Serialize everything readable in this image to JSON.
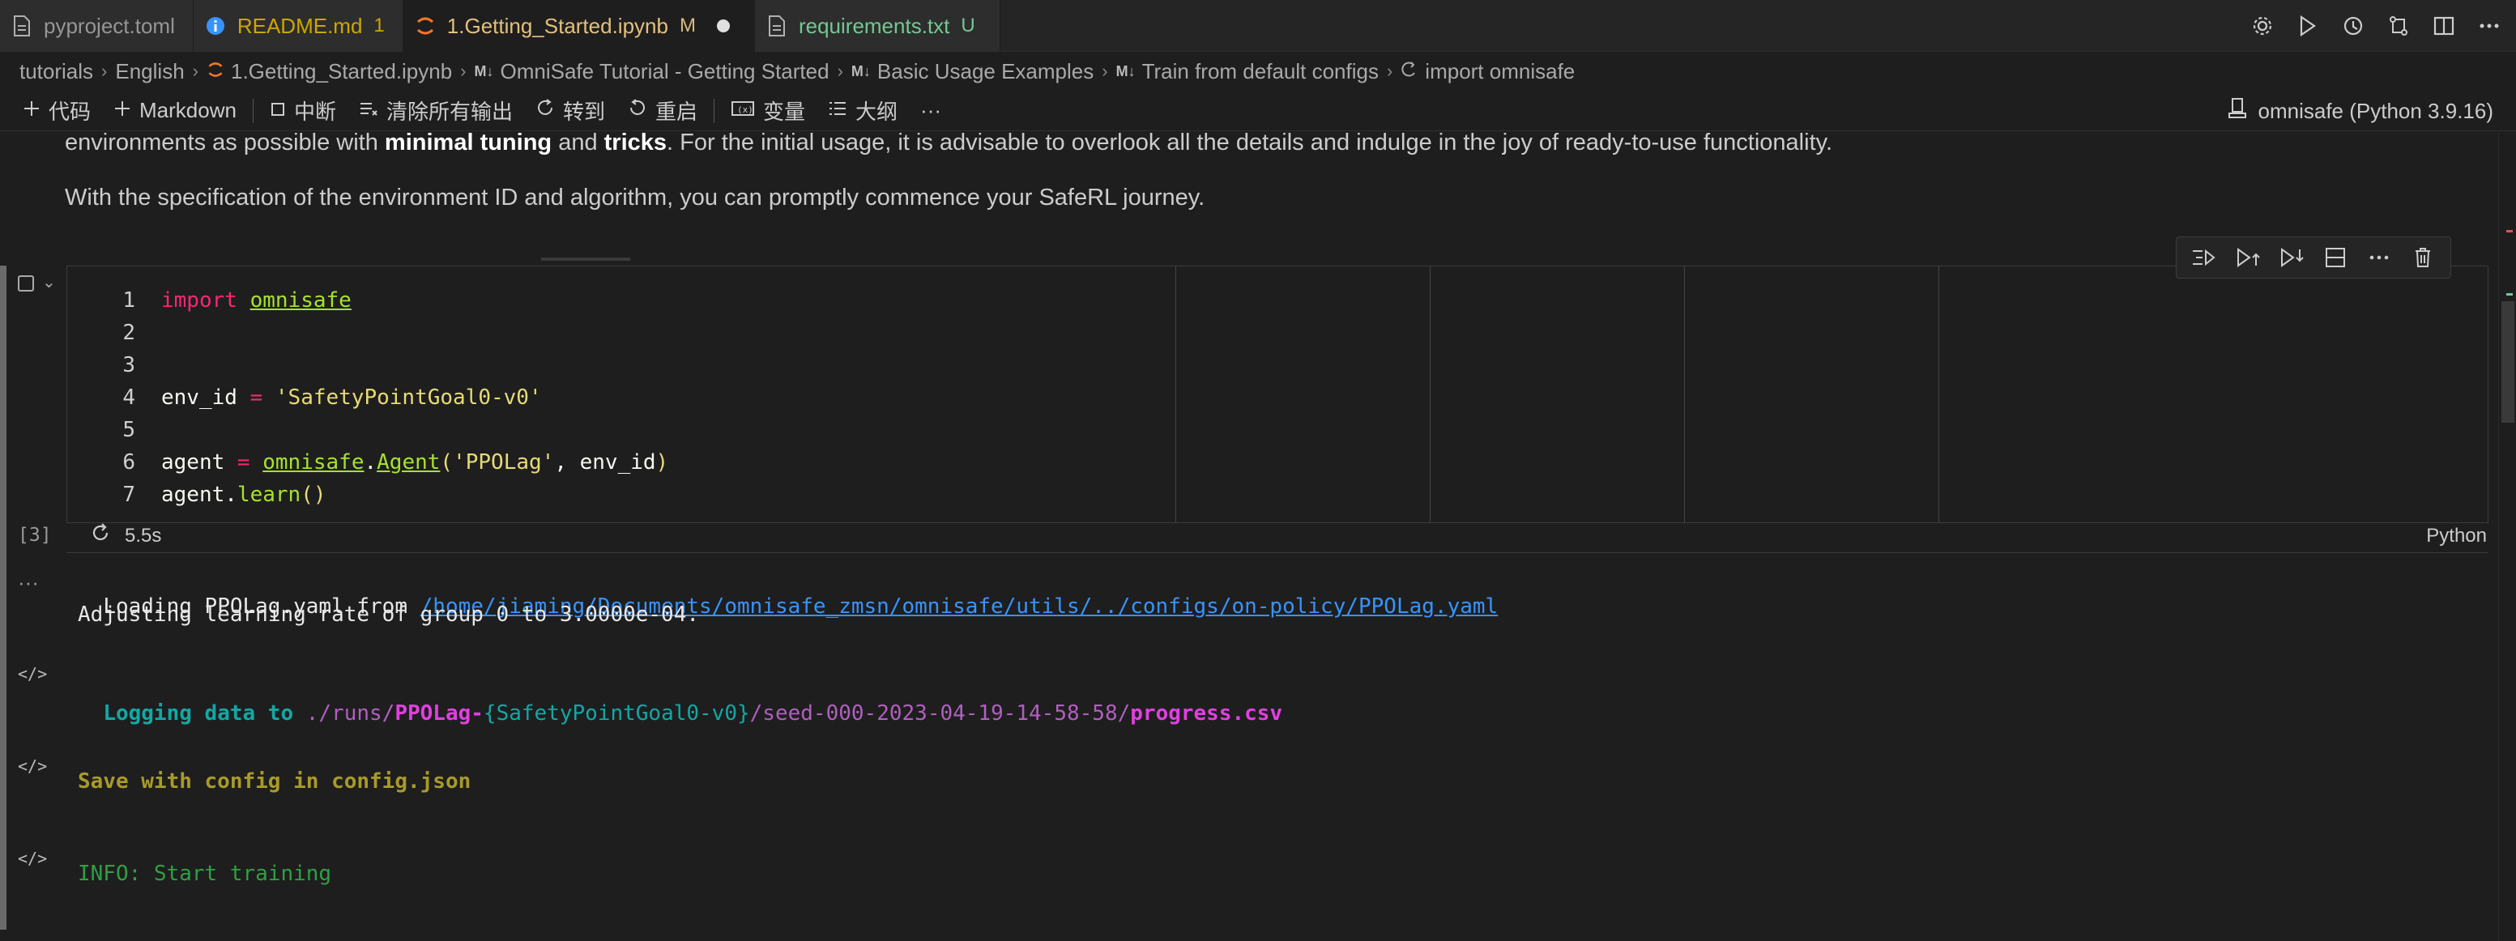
{
  "tabs": [
    {
      "label": "pyproject.toml",
      "badge": ""
    },
    {
      "label": "README.md",
      "badge": "1"
    },
    {
      "label": "1.Getting_Started.ipynb",
      "badge": "M"
    },
    {
      "label": "requirements.txt",
      "badge": "U"
    }
  ],
  "breadcrumb": {
    "c0": "tutorials",
    "c1": "English",
    "c2": "1.Getting_Started.ipynb",
    "c3": "OmniSafe Tutorial - Getting Started",
    "c4": "Basic Usage Examples",
    "c5": "Train from default configs",
    "c6": "import omnisafe",
    "md_badge": "M↓"
  },
  "toolbar": {
    "code": "代码",
    "markdown": "Markdown",
    "interrupt": "中断",
    "clear_outputs": "清除所有输出",
    "goto": "转到",
    "restart": "重启",
    "variables": "变量",
    "outline": "大纲",
    "more": "···",
    "kernel": "omnisafe (Python 3.9.16)"
  },
  "markdown": {
    "l1_pre": "environments as possible with ",
    "l1_b1": "minimal tuning",
    "l1_mid": " and ",
    "l1_b2": "tricks",
    "l1_post": ". For the initial usage, it is advisable to overlook all the details and indulge in the joy of ready-to-use functionality.",
    "l2": "With the specification of the environment ID and algorithm, you can promptly commence your SafeRL journey."
  },
  "cell": {
    "line_numbers": [
      "1",
      "2",
      "3",
      "4",
      "5",
      "6",
      "7"
    ],
    "code": {
      "l1_kw": "import",
      "l1_mod": "omnisafe",
      "l4_var": "env_id",
      "l4_eq": " = ",
      "l4_str": "'SafetyPointGoal0-v0'",
      "l6_var": "agent",
      "l6_eq": " = ",
      "l6_mod": "omnisafe",
      "l6_dot": ".",
      "l6_fn": "Agent",
      "l6_open": "(",
      "l6_str": "'PPOLag'",
      "l6_rest": ", env_id",
      "l6_close": ")",
      "l7_var": "agent",
      "l7_dot": ".",
      "l7_fn": "learn",
      "l7_paren": "()"
    },
    "exec_count": "[3]",
    "duration": "5.5s",
    "language": "Python"
  },
  "output": {
    "more": "···",
    "o1_pre": "Loading PPOLag.yaml from ",
    "o1_link": "/home/jiaming/Documents/omnisafe_zmsn/omnisafe/utils/../configs/on-policy/PPOLag.yaml",
    "o2": "Adjusting learning rate of group 0 to 3.0000e-04.",
    "o3_a": "Logging data to ",
    "o3_b": "./runs/",
    "o3_c": "PPOLag-",
    "o3_d": "{SafetyPointGoal0-v0}",
    "o3_e": "/seed-000-2023-04-19-14-58-58/",
    "o3_f": "progress.csv",
    "o4": "Save with config in config.json",
    "o5": "INFO: Start training"
  },
  "icons": {
    "file": "file-icon",
    "info": "info-icon",
    "jupyter": "jupyter-icon"
  },
  "colors": {
    "accent_link": "#3794ff",
    "modified": "#d7ba7d",
    "untracked": "#73c991",
    "warning": "#cca700"
  }
}
